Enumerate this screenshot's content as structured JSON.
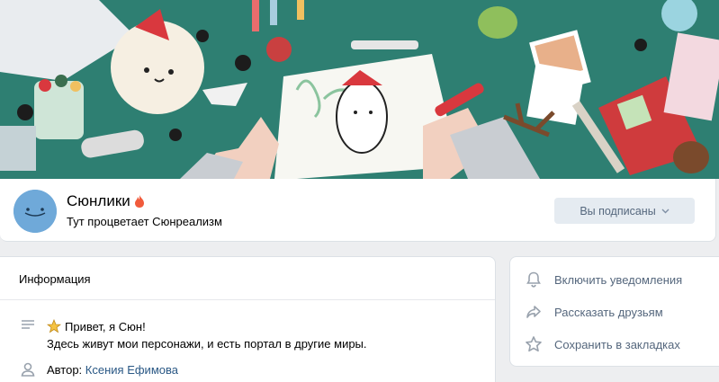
{
  "group": {
    "name": "Сюнлики",
    "status": "Тут процветает Сюнреализм",
    "subscribe_button": "Вы подписаны"
  },
  "info": {
    "title": "Информация",
    "greeting": "Привет, я Сюн!",
    "description": "Здесь живут мои персонажи, и есть портал в другие миры.",
    "author_label": "Автор:",
    "author_name": "Ксения Ефимова"
  },
  "actions": [
    {
      "label": "Включить уведомления",
      "icon": "bell-icon"
    },
    {
      "label": "Рассказать друзьям",
      "icon": "share-icon"
    },
    {
      "label": "Сохранить в закладках",
      "icon": "star-icon"
    }
  ],
  "colors": {
    "cover_bg": "#2e7f72",
    "link": "#2a5885",
    "button_bg": "#e5ebf1",
    "button_text": "#55677d",
    "avatar": "#6fa9d9"
  }
}
